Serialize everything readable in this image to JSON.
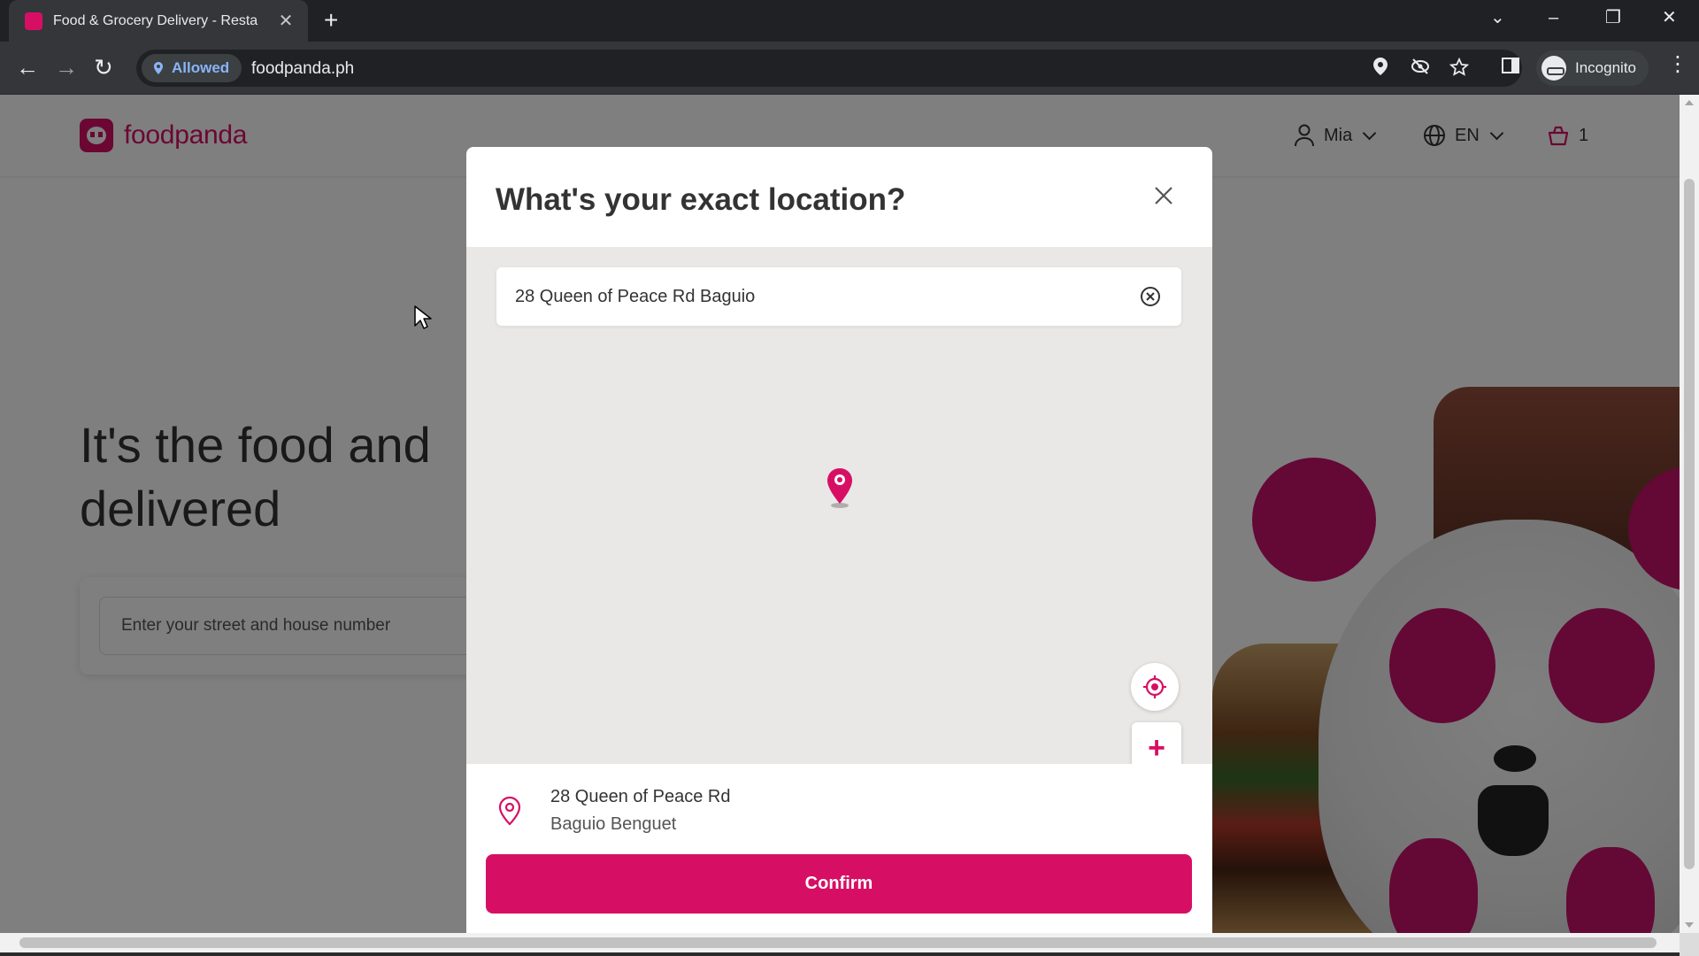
{
  "browser": {
    "tab_title": "Food & Grocery Delivery - Resta",
    "tab_close": "✕",
    "new_tab": "+",
    "permission_label": "Allowed",
    "url": "foodpanda.ph",
    "profile_label": "Incognito"
  },
  "site": {
    "logo_text": "foodpanda",
    "user_name": "Mia",
    "language": "EN",
    "cart_count": "1",
    "hero_title_line1": "It's the food and",
    "hero_title_line2": "delivered",
    "hero_search_placeholder": "Enter your street and house number"
  },
  "modal": {
    "title": "What's your exact location?",
    "search_value": "28 Queen of Peace Rd Baguio",
    "zoom_in": "+",
    "zoom_out": "−",
    "address_line1": "28 Queen of Peace Rd",
    "address_line2": "Baguio Benguet",
    "confirm_label": "Confirm"
  },
  "colors": {
    "brand": "#d70f64"
  },
  "icons": [
    "location-pin-icon",
    "close-icon",
    "clear-icon",
    "crosshair-icon",
    "user-icon",
    "globe-icon",
    "basket-icon",
    "incognito-icon",
    "star-icon",
    "eye-off-icon",
    "sidebar-icon",
    "menu-icon"
  ]
}
